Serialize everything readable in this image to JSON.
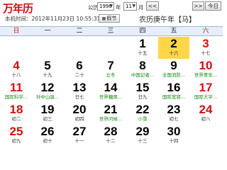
{
  "header": {
    "logo": "万年历",
    "public_label": "公历",
    "year": "1990",
    "year_suffix": "年",
    "month": "11",
    "month_suffix": "月",
    "prev": "<<",
    "next": ">>",
    "today_button": "今日",
    "now_text": "本机时间：2012年11月23日 10:55:31",
    "holiday_button": "假节",
    "lunar_year": "农历庚午年【马】"
  },
  "weekdays": [
    "日",
    "一",
    "二",
    "三",
    "四",
    "五",
    "六"
  ],
  "calendar": {
    "rows": [
      [
        {
          "d": "",
          "s": ""
        },
        {
          "d": "",
          "s": ""
        },
        {
          "d": "",
          "s": ""
        },
        {
          "d": "",
          "s": ""
        },
        {
          "d": "1",
          "s": "十五"
        },
        {
          "d": "2",
          "s": "十六"
        },
        {
          "d": "3",
          "s": "十七"
        }
      ],
      [
        {
          "d": "4",
          "s": "十八"
        },
        {
          "d": "5",
          "s": "十九"
        },
        {
          "d": "6",
          "s": "二十"
        },
        {
          "d": "7",
          "s": "立冬"
        },
        {
          "d": "8",
          "s": "中国记者..."
        },
        {
          "d": "9",
          "s": "全国消防..."
        },
        {
          "d": "10",
          "s": "世界青年..."
        }
      ],
      [
        {
          "d": "11",
          "s": "国际科学..."
        },
        {
          "d": "12",
          "s": "孙中山诞..."
        },
        {
          "d": "13",
          "s": "廿七"
        },
        {
          "d": "14",
          "s": "世界糖尿..."
        },
        {
          "d": "15",
          "s": "廿九"
        },
        {
          "d": "16",
          "s": "国际宽容..."
        },
        {
          "d": "17",
          "s": "国际大学..."
        }
      ],
      [
        {
          "d": "18",
          "s": "初二"
        },
        {
          "d": "19",
          "s": "初三"
        },
        {
          "d": "20",
          "s": "初四"
        },
        {
          "d": "21",
          "s": "世界问候..."
        },
        {
          "d": "22",
          "s": "小雪"
        },
        {
          "d": "23",
          "s": "初七"
        },
        {
          "d": "24",
          "s": "初八"
        }
      ],
      [
        {
          "d": "25",
          "s": "初九"
        },
        {
          "d": "26",
          "s": "初十"
        },
        {
          "d": "27",
          "s": "十一"
        },
        {
          "d": "28",
          "s": "十二"
        },
        {
          "d": "29",
          "s": "十三"
        },
        {
          "d": "30",
          "s": "十四"
        },
        {
          "d": "",
          "s": ""
        }
      ]
    ],
    "today": {
      "row": 0,
      "col": 5
    }
  },
  "green_subs": [
    "立冬",
    "中国记者...",
    "全国消防...",
    "世界青年...",
    "国际科学...",
    "孙中山诞...",
    "世界糖尿...",
    "国际宽容...",
    "国际大学...",
    "世界问候...",
    "小雪"
  ],
  "colors": {
    "weekend_red": "#cc1111",
    "festival_green": "#118811",
    "today_bg": "#ffd54a",
    "header_bg": "#e7eefa"
  }
}
